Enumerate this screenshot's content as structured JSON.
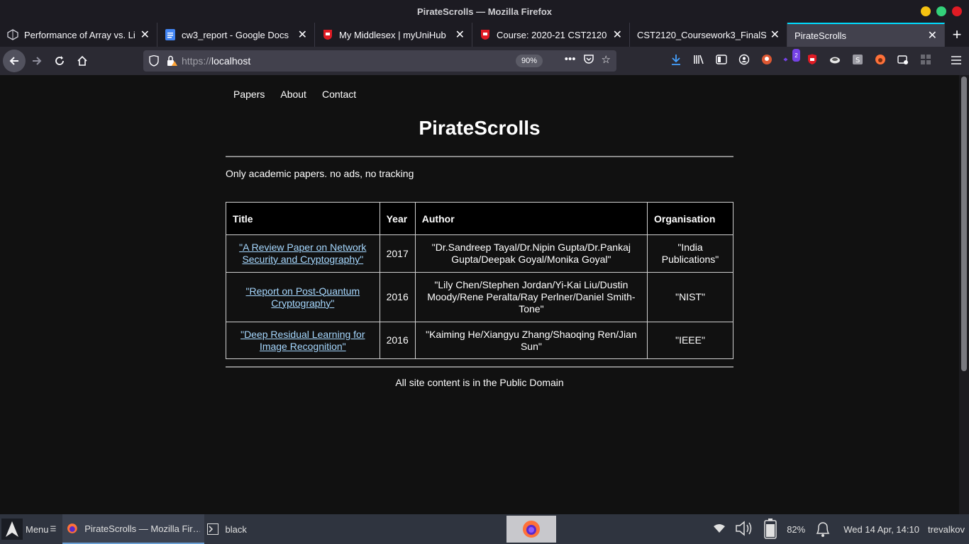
{
  "window": {
    "title": "PirateScrolls — Mozilla Firefox"
  },
  "tabs": [
    {
      "title": "Performance of Array vs. Li",
      "icon": "codepen-icon"
    },
    {
      "title": "cw3_report - Google Docs",
      "icon": "google-docs-icon"
    },
    {
      "title": "My Middlesex | myUniHub",
      "icon": "middlesex-shield-icon"
    },
    {
      "title": "Course: 2020-21 CST2120",
      "icon": "middlesex-shield-icon"
    },
    {
      "title": "CST2120_Coursework3_FinalS",
      "icon": "none"
    },
    {
      "title": "PirateScrolls",
      "icon": "none"
    }
  ],
  "urlbar": {
    "protocol": "https://",
    "host": "localhost",
    "zoom": "90%"
  },
  "toolbar": {
    "extension_badge": "2"
  },
  "site": {
    "nav": [
      "Papers",
      "About",
      "Contact"
    ],
    "title": "PirateScrolls",
    "tagline": "Only academic papers. no ads, no tracking",
    "table": {
      "headers": [
        "Title",
        "Year",
        "Author",
        "Organisation"
      ],
      "rows": [
        {
          "title": "\"A Review Paper on Network Security and Cryptography\"",
          "year": "2017",
          "author": "\"Dr.Sandreep Tayal/Dr.Nipin Gupta/Dr.Pankaj Gupta/Deepak Goyal/Monika Goyal\"",
          "org": "\"India Publications\""
        },
        {
          "title": "\"Report on Post-Quantum Cryptography\"",
          "year": "2016",
          "author": "\"Lily Chen/Stephen Jordan/Yi-Kai Liu/Dustin Moody/Rene Peralta/Ray Perlner/Daniel Smith-Tone\"",
          "org": "\"NIST\""
        },
        {
          "title": "\"Deep Residual Learning for Image Recognition\"",
          "year": "2016",
          "author": "\"Kaiming He/Xiangyu Zhang/Shaoqing Ren/Jian Sun\"",
          "org": "\"IEEE\""
        }
      ]
    },
    "footer": "All site content is in the Public Domain"
  },
  "taskbar": {
    "menu": "Menu",
    "items": [
      "PirateScrolls — Mozilla Fir…",
      "black"
    ],
    "battery": "82%",
    "clock": "Wed 14 Apr, 14:10",
    "user": "trevalkov"
  }
}
